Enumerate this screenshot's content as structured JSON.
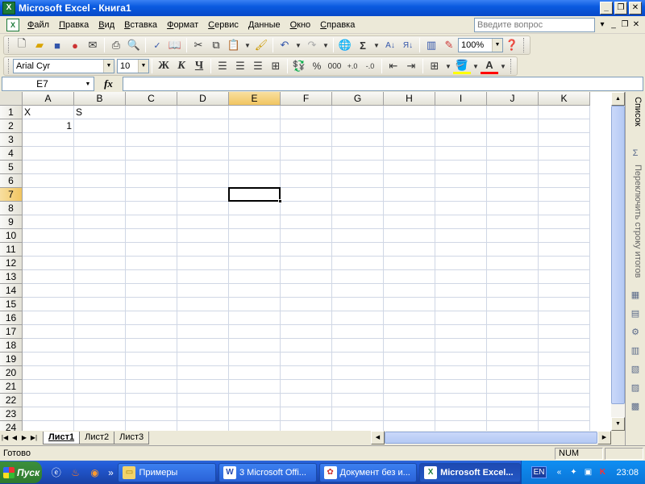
{
  "window": {
    "title": "Microsoft Excel - Книга1",
    "controls": {
      "minimize": "_",
      "maximize": "❐",
      "close": "✕"
    }
  },
  "menu": {
    "items": [
      "Файл",
      "Правка",
      "Вид",
      "Вставка",
      "Формат",
      "Сервис",
      "Данные",
      "Окно",
      "Справка"
    ],
    "ask_placeholder": "Введите вопрос"
  },
  "toolbar": {
    "zoom": "100%",
    "font_name": "Arial Cyr",
    "font_size": "10",
    "bold": "Ж",
    "italic": "К",
    "underline": "Ч",
    "percent": "%",
    "thousands": "000"
  },
  "formula_bar": {
    "name_box": "E7",
    "fx": "fx",
    "value": ""
  },
  "grid": {
    "columns": [
      "A",
      "B",
      "C",
      "D",
      "E",
      "F",
      "G",
      "H",
      "I",
      "J",
      "K"
    ],
    "rows": [
      "1",
      "2",
      "3",
      "4",
      "5",
      "6",
      "7",
      "8",
      "9",
      "10",
      "11",
      "12",
      "13",
      "14",
      "15",
      "16",
      "17",
      "18",
      "19",
      "20",
      "21",
      "22",
      "23",
      "24"
    ],
    "active_column": "E",
    "active_row": "7",
    "active_cell": "E7",
    "cells": [
      {
        "ref": "A1",
        "value": "X"
      },
      {
        "ref": "B1",
        "value": "S"
      },
      {
        "ref": "A2",
        "value": "1",
        "align": "right"
      }
    ]
  },
  "sheets": {
    "tabs": [
      "Лист1",
      "Лист2",
      "Лист3"
    ],
    "active": "Лист1"
  },
  "task_pane": {
    "title": "Список",
    "toggle_label": "Переключить строку итогов"
  },
  "status": {
    "text": "Готово",
    "indicator": "NUM"
  },
  "taskbar": {
    "start": "Пуск",
    "tasks": [
      {
        "label": "Примеры",
        "icon": "folder-icon"
      },
      {
        "label": "3 Microsoft Offi...",
        "icon": "word-icon"
      },
      {
        "label": "Документ без и...",
        "icon": "document-icon"
      },
      {
        "label": "Microsoft Excel...",
        "icon": "excel-icon",
        "active": true
      }
    ],
    "language": "EN",
    "clock": "23:08"
  }
}
